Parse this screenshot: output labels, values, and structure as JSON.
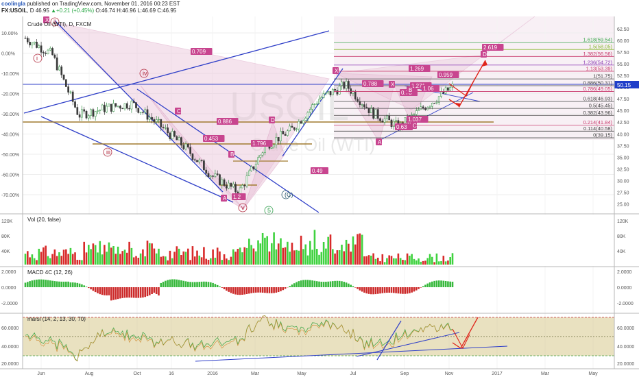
{
  "header": {
    "user": "coolingla",
    "published": "published on TradingView.com, November 01, 2016 00:23 EST",
    "symbol": "FX:USOIL",
    "interval": "D",
    "last": "46.95",
    "change": "+0.21 (+0.45%)",
    "ohlc": "O:46.74 H:46.96 L:46.69 C:46.95"
  },
  "main": {
    "legend": "Crude Oil (WTI), D, FXCM",
    "watermark_symbol": "USOIL",
    "watermark_name": "Crude Oil (WTI)",
    "left_axis_ticks": [
      "10.00%",
      "0.00%",
      "-10.00%",
      "-20.00%",
      "-30.00%",
      "-40.00%",
      "-50.00%",
      "-60.00%",
      "-70.00%"
    ],
    "right_axis_ticks": [
      "62.50",
      "60.00",
      "57.50",
      "55.00",
      "52.50",
      "50.00",
      "47.50",
      "45.00",
      "42.50",
      "40.00",
      "37.50",
      "35.00",
      "32.50",
      "30.00",
      "27.50",
      "25.00"
    ],
    "price_tag": "50.15",
    "fib_levels": [
      {
        "label": "1.618(59.54)",
        "color": "#39a64a"
      },
      {
        "label": "1.5(58.05)",
        "color": "#86b62d"
      },
      {
        "label": "1.382(56.56)",
        "color": "#c83a6c"
      },
      {
        "label": "1.236(54.72)",
        "color": "#8b3bb5"
      },
      {
        "label": "1.13(53.39)",
        "color": "#c83a6c"
      },
      {
        "label": "1(51.75)",
        "color": "#444444"
      },
      {
        "label": "0.886(50.31)",
        "color": "#444444"
      },
      {
        "label": "0.786(49.05)",
        "color": "#c83a6c"
      },
      {
        "label": "0.618(46.93)",
        "color": "#444444"
      },
      {
        "label": "0.5(45.45)",
        "color": "#444444"
      },
      {
        "label": "0.382(43.96)",
        "color": "#444444"
      },
      {
        "label": "0.214(41.84)",
        "color": "#c83a6c"
      },
      {
        "label": "0.114(40.58)",
        "color": "#444444"
      },
      {
        "label": "0(39.15)",
        "color": "#444444"
      }
    ],
    "pattern_ratios": [
      "0.709",
      "0.886",
      "0.453",
      "1.796",
      "0.49",
      "0.788",
      "0.78",
      "1.271",
      "1.06",
      "0.959",
      "1.269",
      "2.619",
      "0.63",
      "1.037",
      "1.2"
    ],
    "pattern_points": [
      "X",
      "A",
      "B",
      "C",
      "D"
    ],
    "wave_labels": [
      "i",
      "ii",
      "iii",
      "iv",
      "v",
      "(C)",
      "5"
    ]
  },
  "volume": {
    "legend": "Vol (20, false)",
    "ticks": [
      "120K",
      "80K",
      "40K"
    ]
  },
  "macd": {
    "legend": "MACD 4C (12, 26)",
    "ticks": [
      "2.0000",
      "0.0000",
      "-2.0000"
    ]
  },
  "marsi": {
    "legend": "marsi (14, 2, 13, 30, 70)",
    "ticks": [
      "60.0000",
      "40.0000",
      "20.0000"
    ]
  },
  "time_axis": [
    "Jun",
    "Aug",
    "Oct",
    "16",
    "2016",
    "Mar",
    "May",
    "Jul",
    "Sep",
    "Nov",
    "2017",
    "Mar",
    "May"
  ],
  "chart_data": {
    "type": "candlestick",
    "title": "Crude Oil (WTI), D, FXCM",
    "xlabel": "",
    "ylabel": "",
    "ylim": [
      24.5,
      63.5
    ],
    "x": [
      "2015-06",
      "2015-07",
      "2015-08",
      "2015-09",
      "2015-10",
      "2015-11",
      "2015-12",
      "2016-01",
      "2016-02",
      "2016-03",
      "2016-04",
      "2016-05",
      "2016-06",
      "2016-07",
      "2016-08",
      "2016-09",
      "2016-10"
    ],
    "values": [
      60.5,
      57.0,
      44.0,
      45.5,
      46.5,
      42.0,
      37.0,
      31.0,
      27.5,
      37.5,
      41.0,
      47.5,
      50.5,
      44.5,
      41.5,
      46.0,
      50.0
    ],
    "last_close": 46.95,
    "colors": {
      "up": "#26b542",
      "down": "#cc2a2a",
      "pattern": "#d58fb8",
      "trend": "#2f3fc8",
      "ma": "#cc2a2a"
    }
  }
}
